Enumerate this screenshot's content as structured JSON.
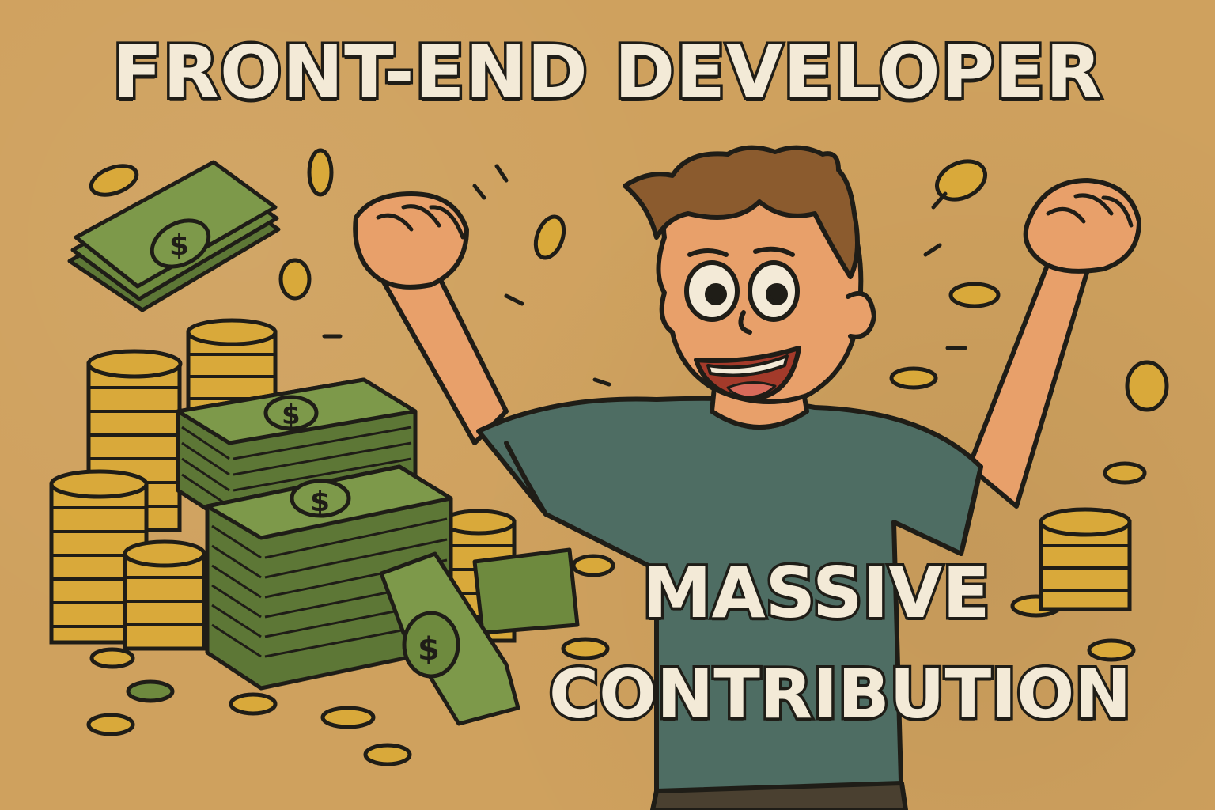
{
  "title": "FRONT-END DEVELOPER",
  "caption": {
    "line1": "MASSIVE",
    "line2": "CONTRIBUTION"
  },
  "colors": {
    "background": "#cfa15e",
    "coin": "#d9a93a",
    "money": "#6e8a3e",
    "shirt": "#4e6d63",
    "skin": "#e8a06a",
    "hair": "#8b5b2e",
    "outline": "#1f1d17",
    "text_fill": "#f3ead7"
  }
}
